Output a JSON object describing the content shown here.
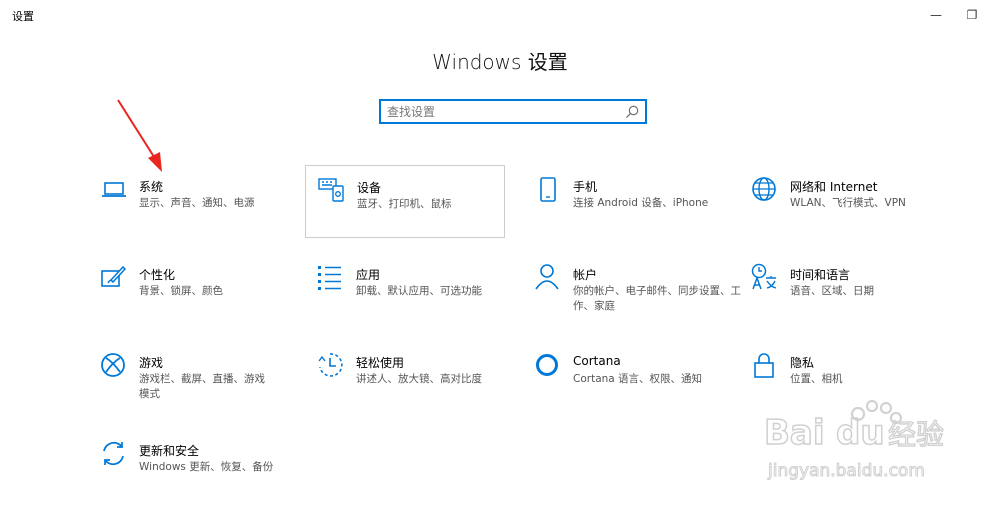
{
  "window": {
    "title": "设置",
    "minimize_glyph": "—",
    "maximize_glyph": "❐"
  },
  "page": {
    "title": "Windows 设置"
  },
  "search": {
    "placeholder": "查找设置",
    "value": ""
  },
  "tiles": [
    {
      "title": "系统",
      "desc": "显示、声音、通知、电源",
      "icon": "laptop-icon"
    },
    {
      "title": "设备",
      "desc": "蓝牙、打印机、鼠标",
      "icon": "keyboard-icon"
    },
    {
      "title": "手机",
      "desc": "连接 Android 设备、iPhone",
      "icon": "phone-icon"
    },
    {
      "title": "网络和 Internet",
      "desc": "WLAN、飞行模式、VPN",
      "icon": "globe-icon"
    },
    {
      "title": "个性化",
      "desc": "背景、锁屏、颜色",
      "icon": "paint-icon"
    },
    {
      "title": "应用",
      "desc": "卸载、默认应用、可选功能",
      "icon": "apps-list-icon"
    },
    {
      "title": "帐户",
      "desc": "你的帐户、电子邮件、同步设置、工作、家庭",
      "icon": "person-icon"
    },
    {
      "title": "时间和语言",
      "desc": "语音、区域、日期",
      "icon": "time-language-icon"
    },
    {
      "title": "游戏",
      "desc": "游戏栏、截屏、直播、游戏模式",
      "icon": "xbox-icon"
    },
    {
      "title": "轻松使用",
      "desc": "讲述人、放大镜、高对比度",
      "icon": "ease-of-access-icon"
    },
    {
      "title": "Cortana",
      "desc": "Cortana 语言、权限、通知",
      "icon": "cortana-icon"
    },
    {
      "title": "隐私",
      "desc": "位置、相机",
      "icon": "lock-icon"
    },
    {
      "title": "更新和安全",
      "desc": "Windows 更新、恢复、备份",
      "icon": "update-icon"
    }
  ],
  "colors": {
    "accent": "#0078d7",
    "annotation_arrow": "#e8261f"
  }
}
